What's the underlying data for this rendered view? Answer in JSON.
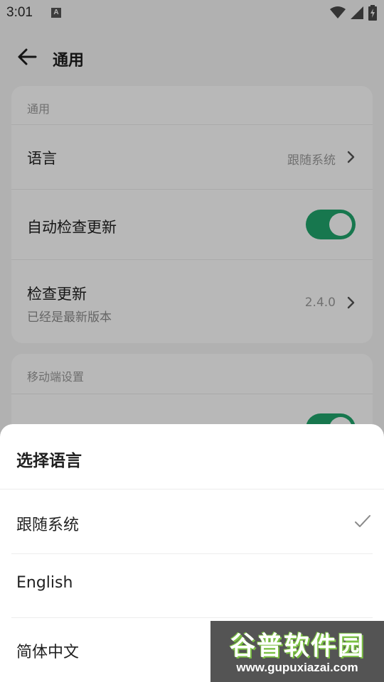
{
  "status_bar": {
    "time": "3:01",
    "notification_letter": "A",
    "icons": [
      "wifi-icon",
      "signal-icon",
      "battery-charging-icon"
    ]
  },
  "app_bar": {
    "title": "通用",
    "back_icon": "arrow-left-icon"
  },
  "general_section": {
    "label": "通用",
    "language": {
      "title": "语言",
      "value": "跟随系统"
    },
    "auto_update": {
      "title": "自动检查更新",
      "enabled": true
    },
    "check_update": {
      "title": "检查更新",
      "subtitle": "已经是最新版本",
      "value": "2.4.0"
    }
  },
  "mobile_section": {
    "label": "移动端设置",
    "first_toggle_enabled": true
  },
  "language_sheet": {
    "title": "选择语言",
    "options": [
      {
        "label": "跟随系统",
        "selected": true
      },
      {
        "label": "English",
        "selected": false
      },
      {
        "label": "简体中文",
        "selected": false
      }
    ]
  },
  "watermark": {
    "title": "谷普软件园",
    "url": "www.gupuxiazai.com"
  },
  "colors": {
    "accent_green": "#21a66c",
    "scrim": "rgba(0,0,0,0.28)"
  }
}
